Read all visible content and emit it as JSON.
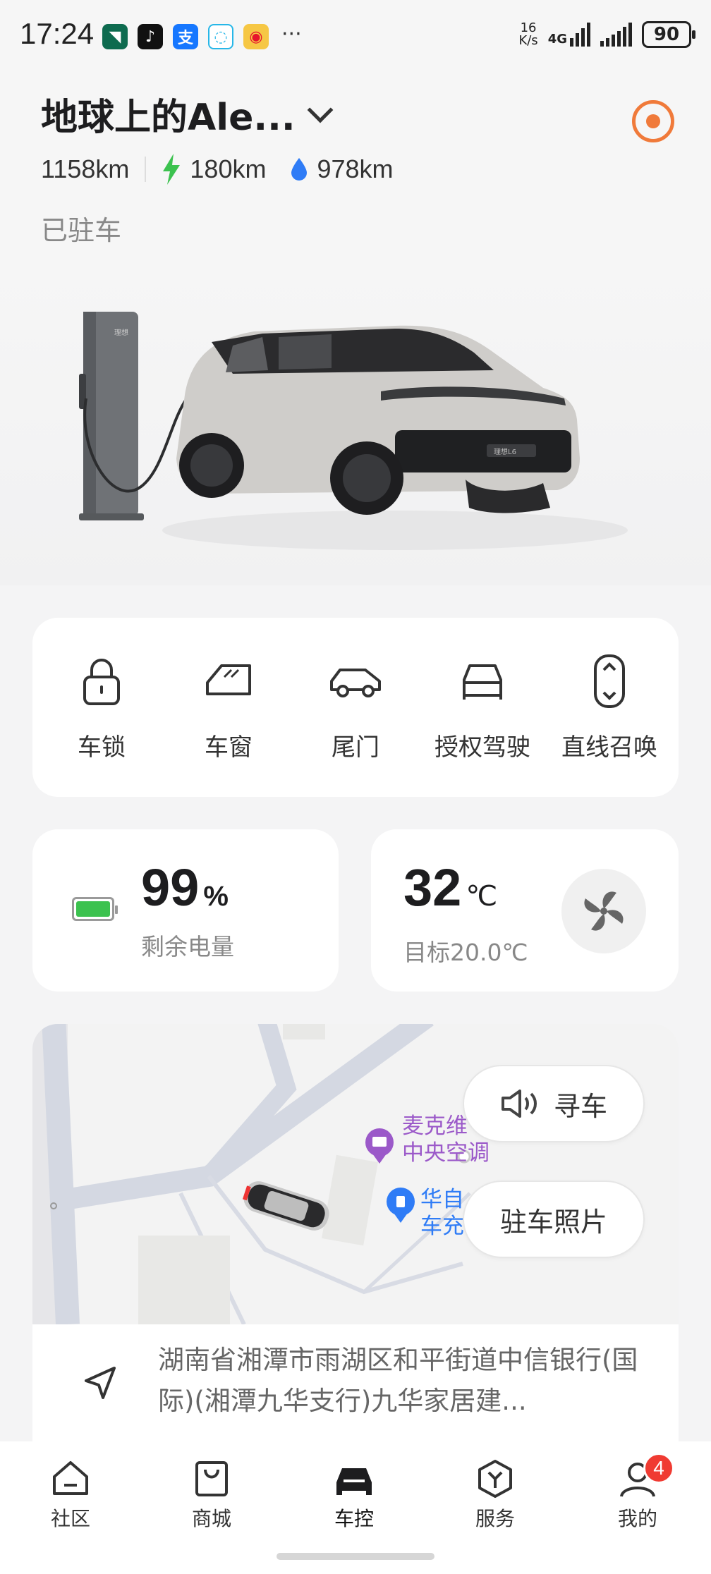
{
  "status_bar": {
    "time": "17:24",
    "net_speed_value": "16",
    "net_speed_unit": "K/s",
    "network_type": "4G",
    "battery_level": "90"
  },
  "vehicle": {
    "name": "地球上的Ale...",
    "total_range": "1158km",
    "electric_range": "180km",
    "fuel_range": "978km",
    "status": "已驻车"
  },
  "controls": [
    {
      "label": "车锁",
      "icon": "lock-icon"
    },
    {
      "label": "车窗",
      "icon": "window-icon"
    },
    {
      "label": "尾门",
      "icon": "tailgate-icon"
    },
    {
      "label": "授权驾驶",
      "icon": "authorized-drive-icon"
    },
    {
      "label": "直线召唤",
      "icon": "straight-summon-icon"
    }
  ],
  "battery": {
    "value": "99",
    "unit": "%",
    "label": "剩余电量",
    "level": 0.99
  },
  "climate": {
    "temp": "32",
    "unit": "℃",
    "target_label": "目标20.0℃"
  },
  "map": {
    "poi_1": "麦克维\n中央空调",
    "poi_2": "华自\n车充",
    "find_car_label": "寻车",
    "parking_photo_label": "驻车照片",
    "address": "湖南省湘潭市雨湖区和平街道中信银行(国际)(湘潭九华支行)九华家居建..."
  },
  "tabbar": [
    {
      "label": "社区",
      "icon": "community-icon"
    },
    {
      "label": "商城",
      "icon": "store-icon"
    },
    {
      "label": "车控",
      "icon": "car-control-icon"
    },
    {
      "label": "服务",
      "icon": "service-icon"
    },
    {
      "label": "我的",
      "icon": "profile-icon",
      "badge": "4"
    }
  ],
  "colors": {
    "accent_orange": "#f07a3a",
    "electric_green": "#3cc24f",
    "fuel_blue": "#2f7cf6",
    "poi_purple": "#9b59c9",
    "poi_blue": "#2f7cf6",
    "badge_red": "#f03b32"
  }
}
